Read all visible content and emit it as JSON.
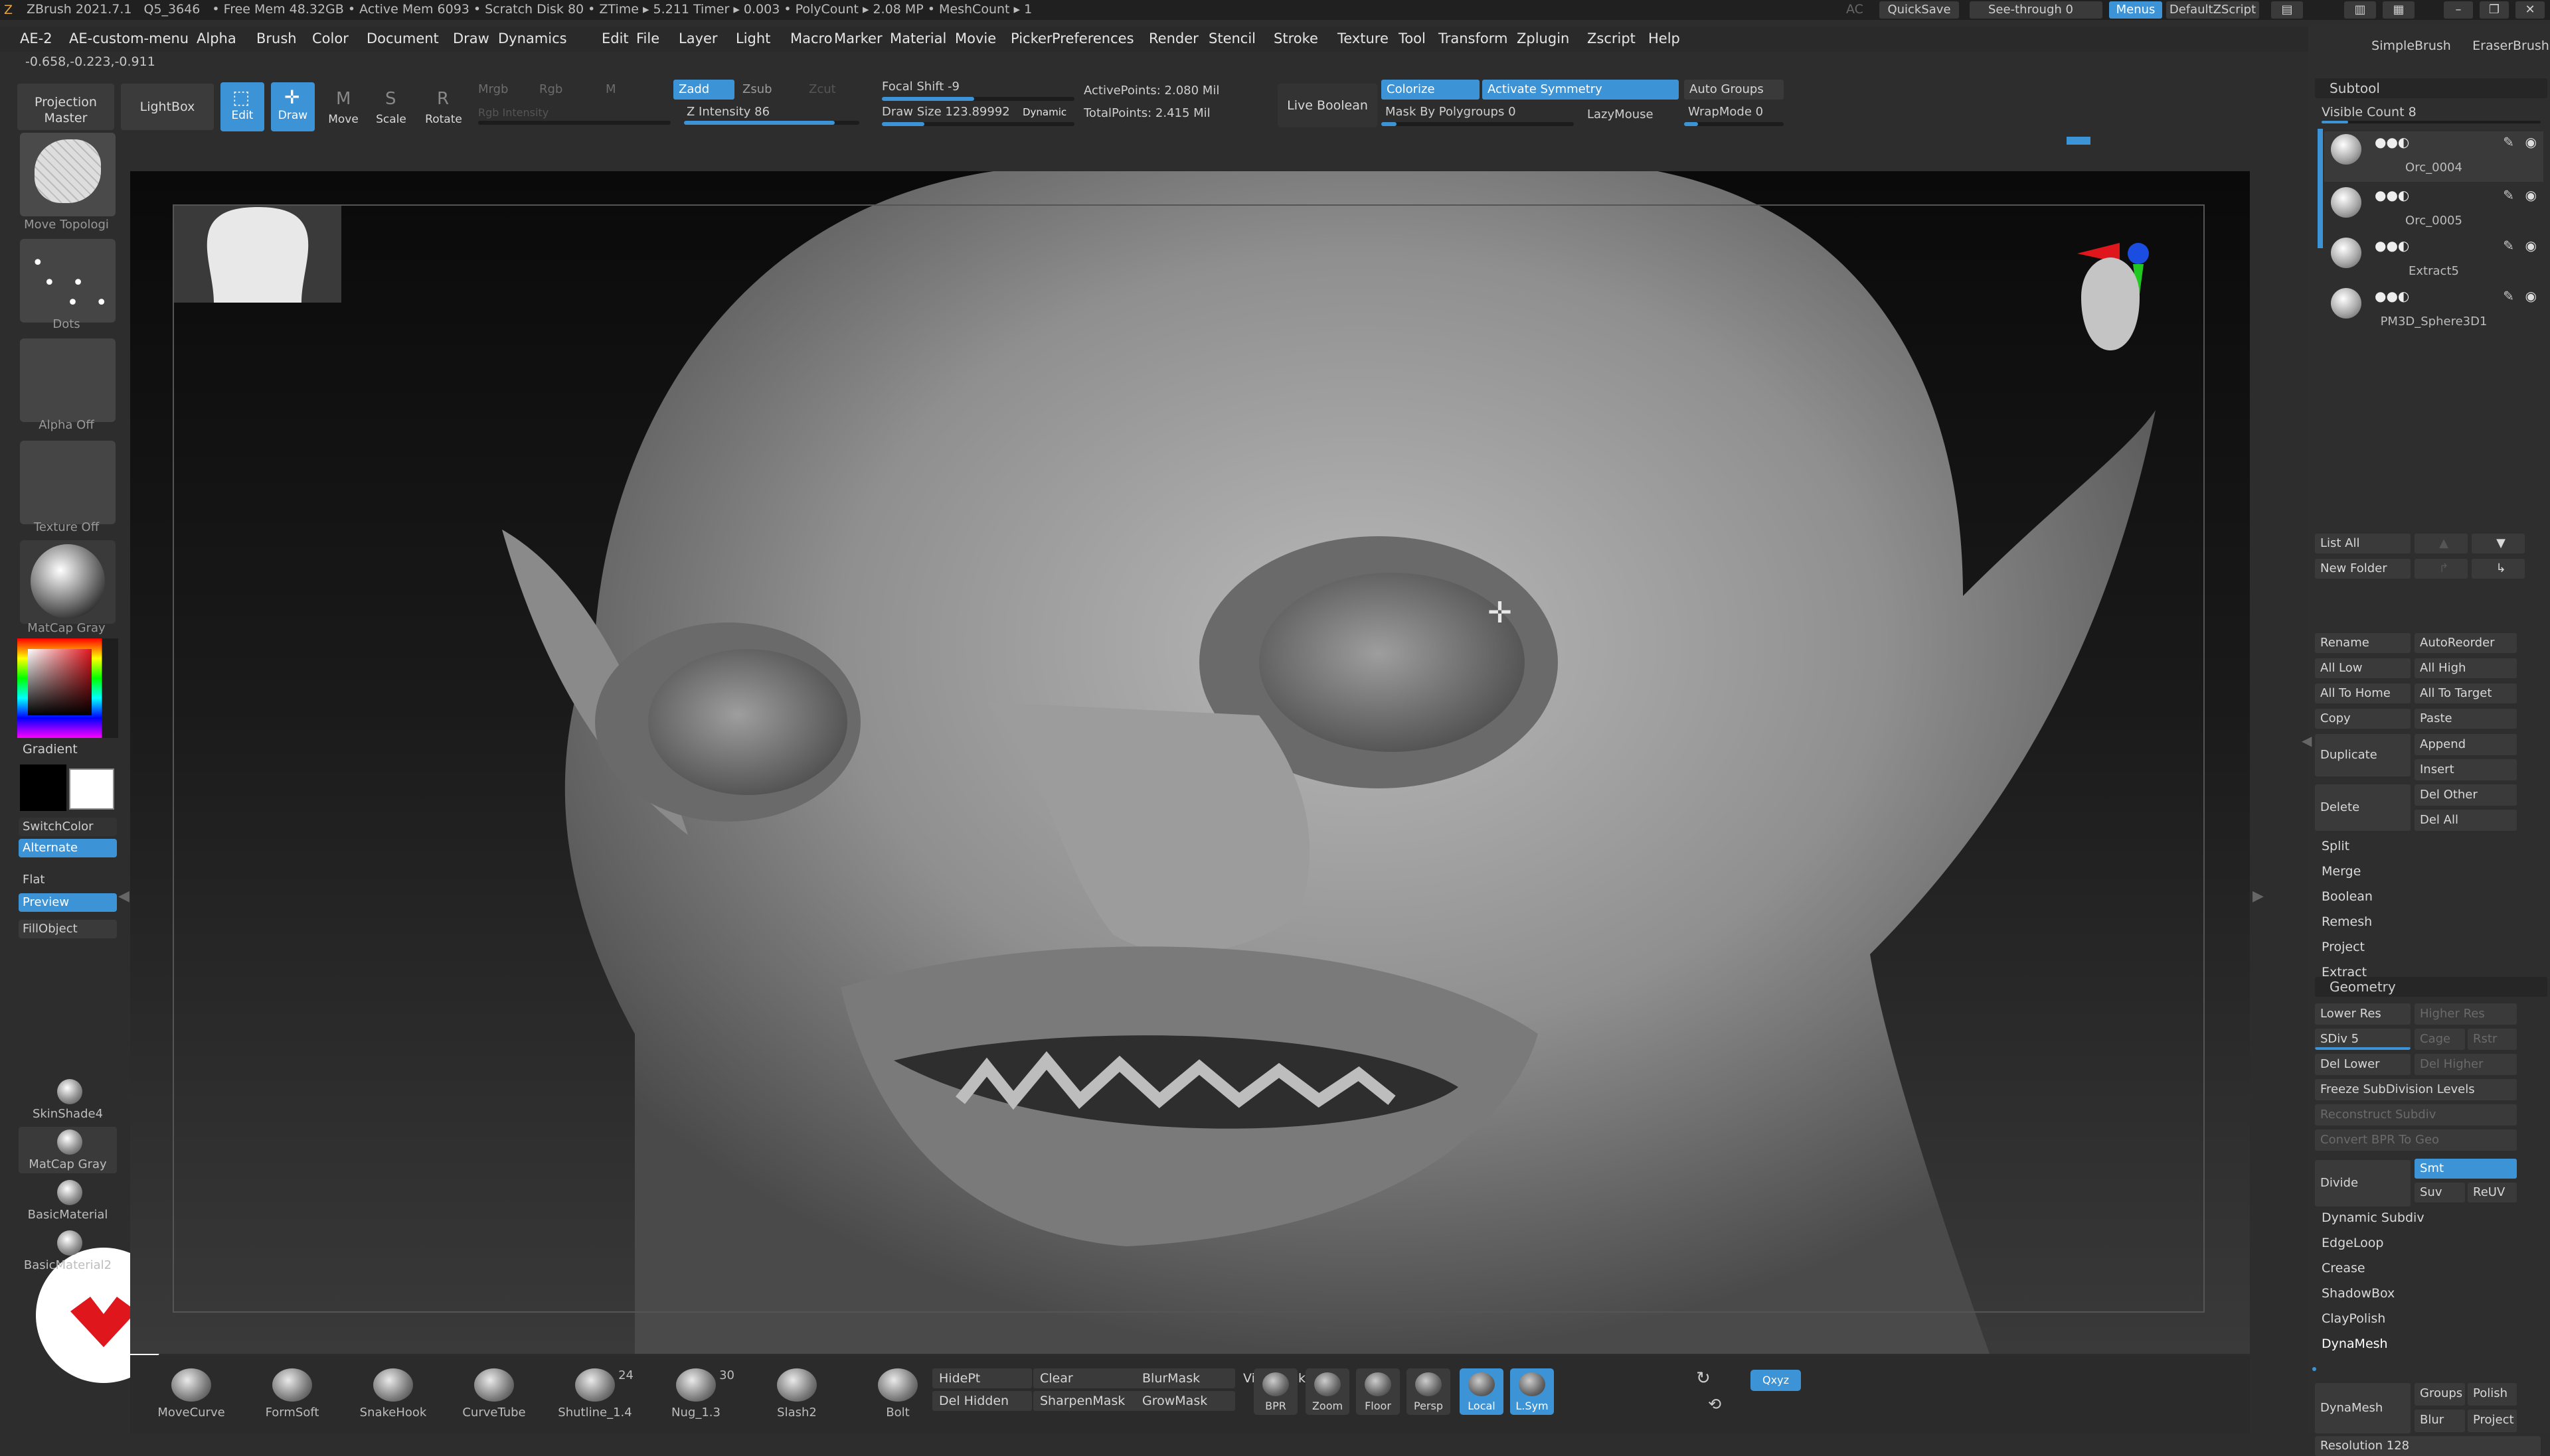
{
  "title_bar": {
    "app_version": "ZBrush 2021.7.1",
    "project": "Q5_3646",
    "stats": "• Free Mem 48.32GB • Active Mem 6093 • Scratch Disk 80 • ZTime ▸ 5.211 Timer ▸ 0.003 • PolyCount ▸ 2.08 MP • MeshCount ▸ 1",
    "ac_label": "AC",
    "quicksave": "QuickSave",
    "see_through": "See-through 0",
    "menus": "Menus",
    "script": "DefaultZScript"
  },
  "menu_bar": [
    "AE-2",
    "AE-custom-menu",
    "Alpha",
    "Brush",
    "Color",
    "Document",
    "Draw",
    "Dynamics",
    "Edit",
    "File",
    "Layer",
    "Light",
    "Macro",
    "Marker",
    "Material",
    "Movie",
    "Picker",
    "Preferences",
    "Render",
    "Stencil",
    "Stroke",
    "Texture",
    "Tool",
    "Transform",
    "Zplugin",
    "Zscript",
    "Help"
  ],
  "coordinates": "-0.658,-0.223,-0.911",
  "toolbar": {
    "projection_master": "Projection Master",
    "lightbox": "LightBox",
    "edit": "Edit",
    "draw": "Draw",
    "move": "Move",
    "scale": "Scale",
    "rotate": "Rotate",
    "mrgb": "Mrgb",
    "rgb": "Rgb",
    "m": "M",
    "rgb_intensity": "Rgb Intensity",
    "zadd": "Zadd",
    "zsub": "Zsub",
    "zcut": "Zcut",
    "z_intensity": "Z Intensity 86",
    "z_intensity_value": 86,
    "focal_shift": "Focal Shift -9",
    "draw_size": "Draw Size 123.89992",
    "dynamic": "Dynamic",
    "active_points": "ActivePoints: 2.080 Mil",
    "total_points": "TotalPoints: 2.415 Mil",
    "live_boolean": "Live Boolean",
    "colorize": "Colorize",
    "activate_symmetry": "Activate Symmetry",
    "auto_groups": "Auto Groups",
    "mask_by_polygroups": "Mask By Polygroups 0",
    "lazymouse": "LazyMouse",
    "wrapmode": "WrapMode 0"
  },
  "left_shelf": {
    "brush_caption": "Move Topologi",
    "stroke_caption": "Dots",
    "alpha_caption": "Alpha Off",
    "texture_caption": "Texture Off",
    "material_caption": "MatCap Gray",
    "gradient": "Gradient",
    "switchcolor": "SwitchColor",
    "alternate": "Alternate",
    "flat": "Flat",
    "preview": "Preview",
    "fillobject": "FillObject",
    "materials": [
      "SkinShade4",
      "MatCap Gray",
      "BasicMaterial",
      "BasicMaterial2"
    ]
  },
  "right_panel": {
    "top_brushes": [
      "SimpleBrush",
      "EraserBrush"
    ],
    "subtool_header": "Subtool",
    "visible_count": "Visible Count 8",
    "subtools": [
      "Orc_0004",
      "Orc_0005",
      "Extract5",
      "PM3D_Sphere3D1"
    ],
    "list_all": "List All",
    "new_folder": "New Folder",
    "buttons_left": [
      "Rename",
      "All Low",
      "All To Home",
      "Copy"
    ],
    "buttons_right": [
      "AutoReorder",
      "All High",
      "All To Target",
      "Paste"
    ],
    "duplicate": "Duplicate",
    "append": "Append",
    "insert": "Insert",
    "delete": "Delete",
    "del_other": "Del Other",
    "del_all": "Del All",
    "actions": [
      "Split",
      "Merge",
      "Boolean",
      "Remesh",
      "Project",
      "Extract"
    ],
    "geometry_header": "Geometry",
    "lower_res": "Lower Res",
    "higher_res": "Higher Res",
    "sdiv": "SDiv 5",
    "cage": "Cage",
    "rstr": "Rstr",
    "del_lower": "Del Lower",
    "del_higher": "Del Higher",
    "freeze": "Freeze SubDivision Levels",
    "reconstruct": "Reconstruct Subdiv",
    "convert_bpr": "Convert BPR To Geo",
    "divide": "Divide",
    "smt": "Smt",
    "suv": "Suv",
    "reuv": "ReUV",
    "geometry_items": [
      "Dynamic Subdiv",
      "EdgeLoop",
      "Crease",
      "ShadowBox",
      "ClayPolish",
      "DynaMesh"
    ],
    "dynamesh_button": "DynaMesh",
    "groups": "Groups",
    "polish": "Polish",
    "blur": "Blur",
    "project": "Project",
    "resolution": "Resolution 128"
  },
  "bottom_bar": {
    "brushes": [
      {
        "name": "MoveCurve",
        "count": ""
      },
      {
        "name": "FormSoft",
        "count": ""
      },
      {
        "name": "SnakeHook",
        "count": ""
      },
      {
        "name": "CurveTube",
        "count": ""
      },
      {
        "name": "Shutline_1.4",
        "count": "24"
      },
      {
        "name": "Nug_1.3",
        "count": "30"
      },
      {
        "name": "Slash2",
        "count": ""
      },
      {
        "name": "Bolt",
        "count": ""
      }
    ],
    "mask_buttons": [
      "HidePt",
      "Clear",
      "BlurMask",
      "ViewMask",
      "Del Hidden",
      "SharpenMask",
      "GrowMask"
    ],
    "view_buttons": [
      "BPR",
      "Zoom",
      "Floor",
      "Persp",
      "Local",
      "L.Sym"
    ],
    "xyz": "Qxyz"
  },
  "colors": {
    "accent": "#3c93d6",
    "logo_red": "#e0161d"
  }
}
